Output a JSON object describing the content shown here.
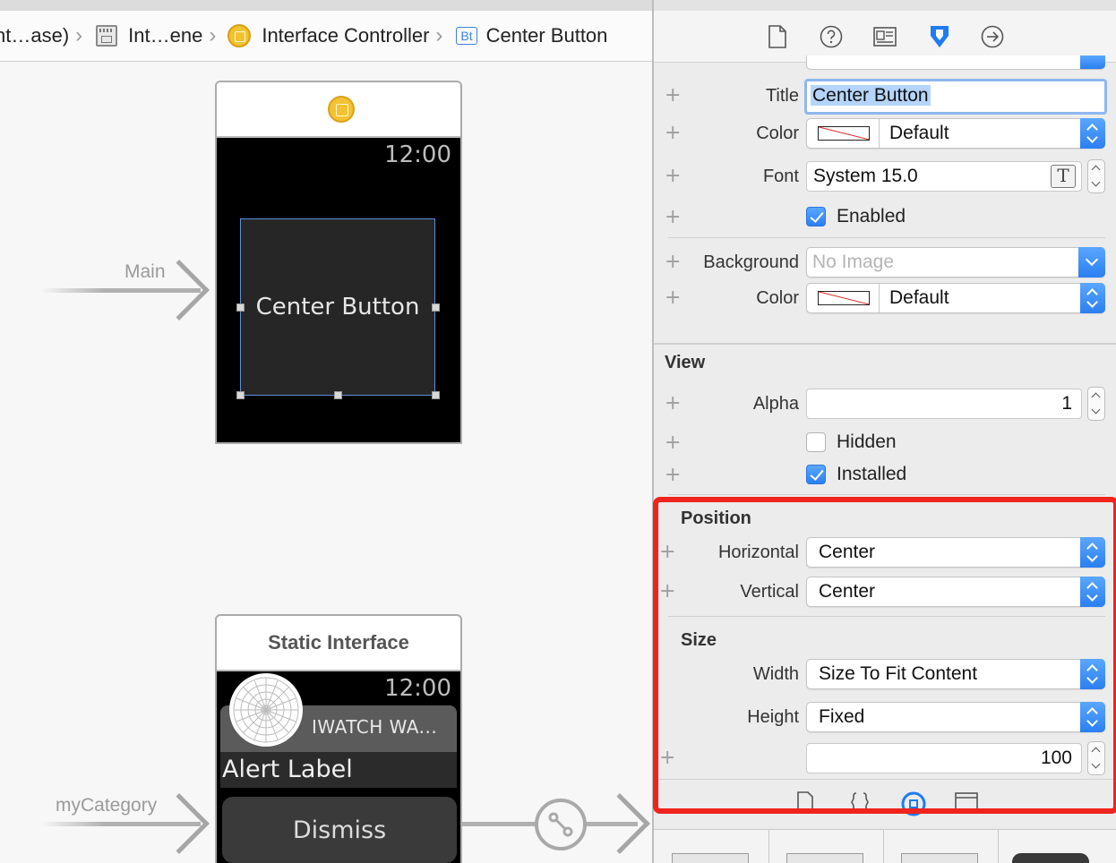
{
  "breadcrumb": {
    "item1": "nt…ase)",
    "item2": "Int…ene",
    "item3": "Interface Controller",
    "item4": "Center Button",
    "item4_badge": "Bt"
  },
  "canvas": {
    "main_scene": {
      "time": "12:00",
      "button_title": "Center Button",
      "segue_label": "Main"
    },
    "static_scene": {
      "title": "Static Interface",
      "time": "12:00",
      "app_name": "IWATCH WA...",
      "alert_label": "Alert Label",
      "dismiss_label": "Dismiss",
      "segue_label": "myCategory"
    }
  },
  "inspector": {
    "toolbar_icons": [
      "file-inspector-icon",
      "quick-help-icon",
      "identity-inspector-icon",
      "attributes-inspector-icon",
      "connections-inspector-icon"
    ],
    "button": {
      "title_label": "Title",
      "title_value": "Center Button",
      "color_label": "Color",
      "color_value": "Default",
      "font_label": "Font",
      "font_value": "System 15.0",
      "enabled_label": "Enabled",
      "enabled": true,
      "background_label": "Background",
      "background_placeholder": "No Image",
      "bg_color_label": "Color",
      "bg_color_value": "Default"
    },
    "view": {
      "section_title": "View",
      "alpha_label": "Alpha",
      "alpha_value": "1",
      "hidden_label": "Hidden",
      "hidden": false,
      "installed_label": "Installed",
      "installed": true
    },
    "position": {
      "section_title": "Position",
      "horizontal_label": "Horizontal",
      "horizontal_value": "Center",
      "vertical_label": "Vertical",
      "vertical_value": "Center"
    },
    "size": {
      "section_title": "Size",
      "width_label": "Width",
      "width_value": "Size To Fit Content",
      "height_label": "Height",
      "height_value": "Fixed",
      "height_amount": "100"
    }
  },
  "colors": {
    "highlight": "#f0241c",
    "accent_blue": "#2b7ff0",
    "selection_blue": "#b5d4fb"
  }
}
